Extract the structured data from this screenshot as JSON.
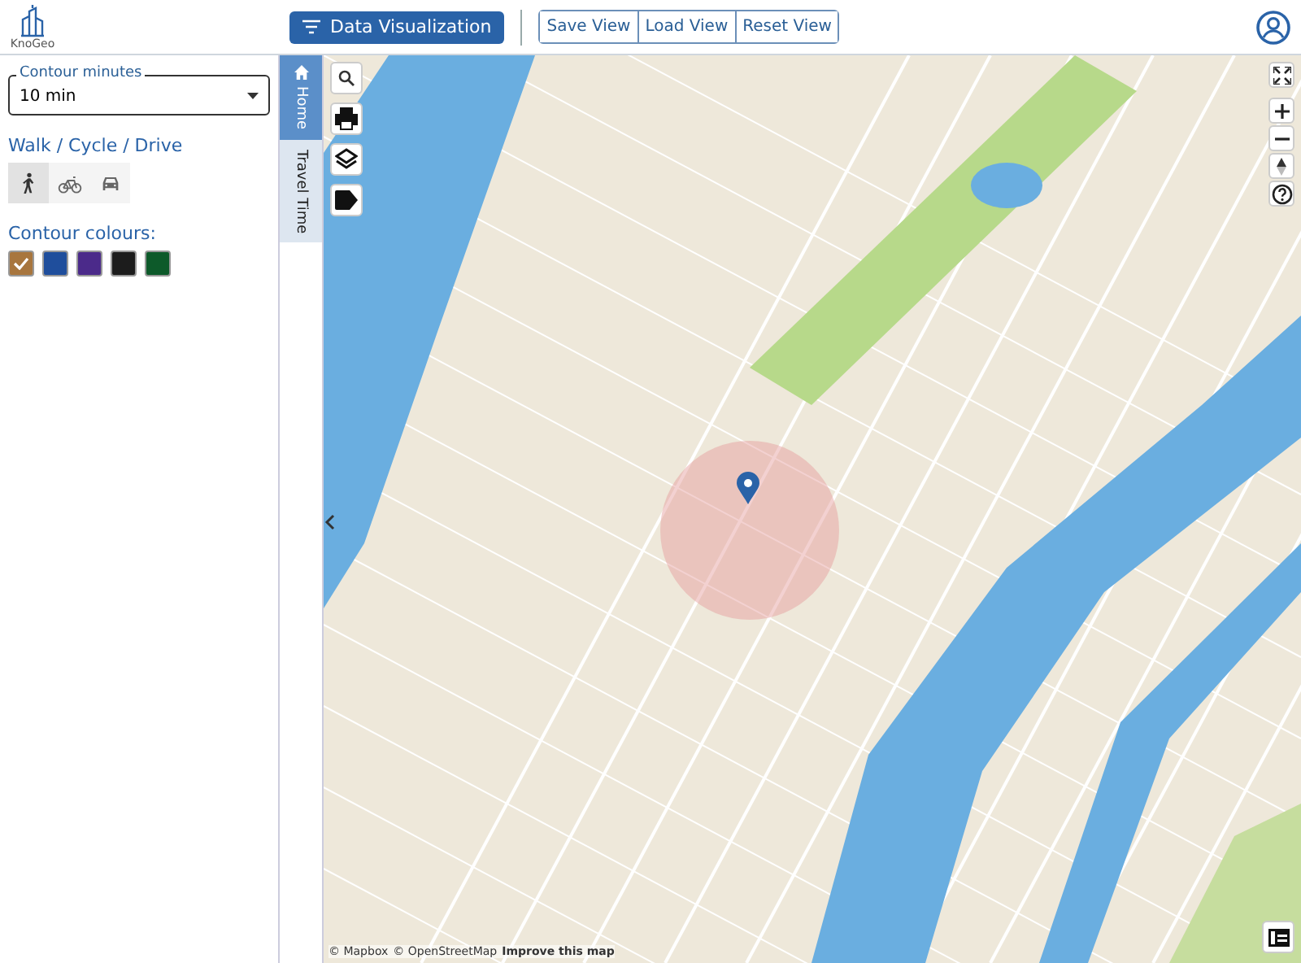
{
  "app": {
    "logo_text": "KnoGeo"
  },
  "toolbar": {
    "primary_button": "Data Visualization",
    "view_buttons": [
      "Save View",
      "Load View",
      "Reset View"
    ]
  },
  "panel": {
    "contour_field": {
      "label": "Contour minutes",
      "value": "10 min"
    },
    "mode_heading": "Walk / Cycle / Drive",
    "modes": [
      {
        "kind": "walk",
        "selected": true
      },
      {
        "kind": "cycle",
        "selected": false
      },
      {
        "kind": "drive",
        "selected": false
      }
    ],
    "colours_heading": "Contour colours:",
    "colours": [
      {
        "color": "#a8763e",
        "selected": true
      },
      {
        "color": "#1f4e9c",
        "selected": false
      },
      {
        "color": "#4b2a8a",
        "selected": false
      },
      {
        "color": "#1c1c1c",
        "selected": false
      },
      {
        "color": "#0d5a2a",
        "selected": false
      }
    ]
  },
  "side_tabs": [
    {
      "label": "Home",
      "selected": false
    },
    {
      "label": "Travel Time",
      "selected": true
    }
  ],
  "map": {
    "attribution": [
      "© Mapbox",
      "© OpenStreetMap",
      "Improve this map"
    ]
  }
}
